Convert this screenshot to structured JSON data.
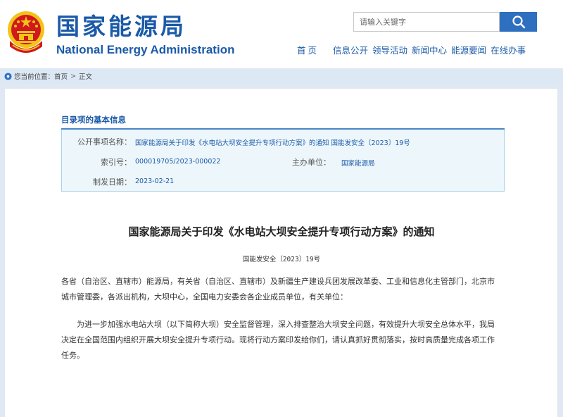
{
  "header": {
    "brand_cn": "国家能源局",
    "brand_en": "National Energy Administration",
    "search_placeholder": "请输入关键字",
    "nav": [
      "首页",
      "信息公开",
      "领导活动",
      "新闻中心",
      "能源要闻",
      "在线办事"
    ]
  },
  "breadcrumb": {
    "label": "您当前位置：",
    "home": "首页",
    "separator": ">",
    "current": "正文"
  },
  "info": {
    "title": "目录项的基本信息",
    "rows": {
      "subject_label": "公开事项名称：",
      "subject_value": "国家能源局关于印发《水电站大坝安全提升专项行动方案》的通知 国能发安全〔2023〕19号",
      "index_label": "索引号：",
      "index_value": "000019705/2023-000022",
      "org_label": "主办单位：",
      "org_value": "国家能源局",
      "date_label": "制发日期：",
      "date_value": "2023-02-21"
    }
  },
  "article": {
    "title": "国家能源局关于印发《水电站大坝安全提升专项行动方案》的通知",
    "doc_no": "国能发安全〔2023〕19号",
    "p1_line1": "各省（自治区、直辖市）能源局，有关省（自治区、直辖市）及新疆生产建设兵团发展改革委、工业和信息化主管部门，北京市",
    "p1_line2": "城市管理委，各派出机构，大坝中心，全国电力安委会各企业成员单位，有关单位：",
    "p2_line1": "为进一步加强水电站大坝（以下简称大坝）安全监督管理，深入排查整治大坝安全问题，有效提升大坝安全总体水平，我局",
    "p2_line2": "决定在全国范围内组织开展大坝安全提升专项行动。现将行动方案印发给你们，请认真抓好贯彻落实，按时高质量完成各项工作",
    "p2_line3": "任务。"
  },
  "colors": {
    "brand_blue": "#1a5aa8",
    "search_button": "#2f6fc0",
    "band": "#dde8f5",
    "info_bg": "#edf6fb",
    "emblem_red": "#d0181e",
    "emblem_gold": "#f3c318"
  },
  "icons": [
    "national-emblem-icon",
    "search-icon",
    "location-icon"
  ]
}
